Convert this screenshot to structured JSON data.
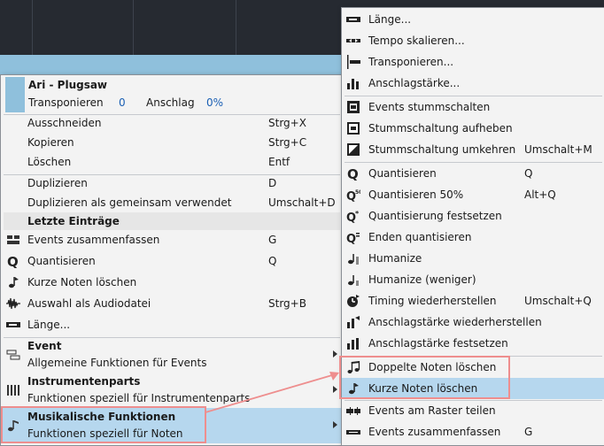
{
  "main_menu": {
    "header": {
      "title": "Ari - Plugsaw",
      "transpose_label": "Transponieren",
      "transpose_value": "0",
      "velocity_label": "Anschlag",
      "velocity_value": "0%"
    },
    "edit_items": [
      {
        "label": "Ausschneiden",
        "shortcut": "Strg+X"
      },
      {
        "label": "Kopieren",
        "shortcut": "Strg+C"
      },
      {
        "label": "Löschen",
        "shortcut": "Entf"
      }
    ],
    "dup_items": [
      {
        "label": "Duplizieren",
        "shortcut": "D"
      },
      {
        "label": "Duplizieren als gemeinsam verwendet",
        "shortcut": "Umschalt+D"
      }
    ],
    "recent_title": "Letzte Einträge",
    "recent_items": [
      {
        "label": "Events zusammenfassen",
        "shortcut": "G",
        "icon": "merge-icon"
      },
      {
        "label": "Quantisieren",
        "shortcut": "Q",
        "icon": "quantize-icon"
      },
      {
        "label": "Kurze Noten löschen",
        "shortcut": "",
        "icon": "short-notes-icon"
      },
      {
        "label": "Auswahl als Audiodatei",
        "shortcut": "Strg+B",
        "icon": "waveform-icon"
      },
      {
        "label": "Länge...",
        "shortcut": "",
        "icon": "length-icon"
      }
    ],
    "groups": [
      {
        "title": "Event",
        "desc": "Allgemeine Funktionen für Events",
        "icon": "event-icon"
      },
      {
        "title": "Instrumentenparts",
        "desc": "Funktionen speziell für Instrumentenparts",
        "icon": "piano-icon"
      },
      {
        "title": "Musikalische Funktionen",
        "desc": "Funktionen speziell für Noten",
        "icon": "music-note-icon"
      }
    ]
  },
  "sub_menu": {
    "items": [
      {
        "label": "Länge...",
        "shortcut": "",
        "icon": "length-icon"
      },
      {
        "label": "Tempo skalieren...",
        "shortcut": "",
        "icon": "tempo-scale-icon"
      },
      {
        "label": "Transponieren...",
        "shortcut": "",
        "icon": "transpose-icon"
      },
      {
        "label": "Anschlagstärke...",
        "shortcut": "",
        "icon": "velocity-icon"
      },
      {
        "label": "Events stummschalten",
        "shortcut": "",
        "icon": "mute-icon"
      },
      {
        "label": "Stummschaltung aufheben",
        "shortcut": "",
        "icon": "unmute-icon"
      },
      {
        "label": "Stummschaltung umkehren",
        "shortcut": "Umschalt+M",
        "icon": "invert-mute-icon"
      },
      {
        "label": "Quantisieren",
        "shortcut": "Q",
        "icon": "quantize-icon"
      },
      {
        "label": "Quantisieren 50%",
        "shortcut": "Alt+Q",
        "icon": "quantize-50-icon"
      },
      {
        "label": "Quantisierung festsetzen",
        "shortcut": "",
        "icon": "quantize-freeze-icon"
      },
      {
        "label": "Enden quantisieren",
        "shortcut": "",
        "icon": "quantize-ends-icon"
      },
      {
        "label": "Humanize",
        "shortcut": "",
        "icon": "humanize-icon"
      },
      {
        "label": "Humanize (weniger)",
        "shortcut": "",
        "icon": "humanize-less-icon"
      },
      {
        "label": "Timing wiederherstellen",
        "shortcut": "Umschalt+Q",
        "icon": "restore-timing-icon"
      },
      {
        "label": "Anschlagstärke wiederherstellen",
        "shortcut": "",
        "icon": "restore-velocity-icon"
      },
      {
        "label": "Anschlagstärke festsetzen",
        "shortcut": "",
        "icon": "freeze-velocity-icon"
      },
      {
        "label": "Doppelte Noten löschen",
        "shortcut": "",
        "icon": "duplicate-notes-icon"
      },
      {
        "label": "Kurze Noten löschen",
        "shortcut": "",
        "icon": "short-notes-icon"
      },
      {
        "label": "Events am Raster teilen",
        "shortcut": "",
        "icon": "split-grid-icon"
      },
      {
        "label": "Events zusammenfassen",
        "shortcut": "G",
        "icon": "merge-icon"
      }
    ]
  },
  "colors": {
    "highlight": "#b6d7ee",
    "annotation": "#ee8e8e",
    "header_swatch": "#8fc0dc"
  }
}
